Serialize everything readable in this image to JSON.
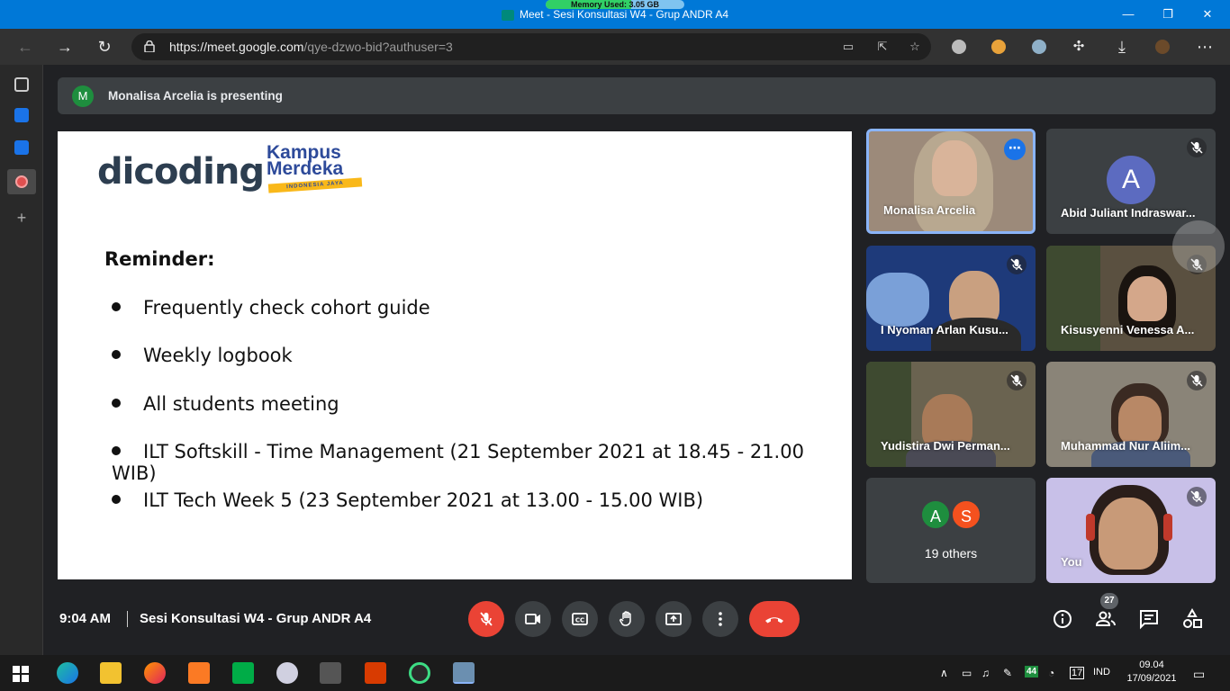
{
  "window": {
    "title": "Meet - Sesi Konsultasi W4 - Grup ANDR A4",
    "memory_label": "Memory Used: 3.05 GB",
    "minimize": "—",
    "restore": "❐",
    "close": "✕"
  },
  "browser": {
    "url_host": "https://meet.google.com",
    "url_path": "/qye-dzwo-bid?authuser=3"
  },
  "banner": {
    "avatar_letter": "M",
    "text": "Monalisa Arcelia is presenting"
  },
  "slide": {
    "logo_left": "dicoding",
    "logo_right_line1": "Kampus",
    "logo_right_line2": "Merdeka",
    "logo_right_tagline": "INDONESIA JAYA",
    "heading": "Reminder:",
    "bullets": [
      "Frequently check cohort guide",
      "Weekly logbook",
      "All students meeting",
      "ILT Softskill - Time Management (21 September 2021 at 18.45 - 21.00 WIB)",
      "ILT Tech Week 5 (23 September 2021 at 13.00 - 15.00 WIB)"
    ]
  },
  "participants": [
    {
      "name": "Monalisa Arcelia"
    },
    {
      "name": "Abid Juliant Indraswar...",
      "avatar_letter": "A"
    },
    {
      "name": "I Nyoman Arlan Kusu..."
    },
    {
      "name": "Kisusyenni Venessa A..."
    },
    {
      "name": "Yudistira Dwi Perman..."
    },
    {
      "name": "Muhammad Nur Aliim..."
    },
    {
      "name": "19 others",
      "avatars": [
        "A",
        "S"
      ]
    },
    {
      "name": "You"
    }
  ],
  "controls": {
    "time": "9:04 AM",
    "meeting_title": "Sesi Konsultasi W4 - Grup ANDR A4",
    "participants_count": "27"
  },
  "taskbar": {
    "lang": "IND",
    "time": "09.04",
    "date": "17/09/2021",
    "badge": "44",
    "calendar_day": "17"
  },
  "colors": {
    "meet_bg": "#202124",
    "tile_bg": "#3c4043",
    "end_call": "#ea4335",
    "titlebar": "#0078d7"
  }
}
